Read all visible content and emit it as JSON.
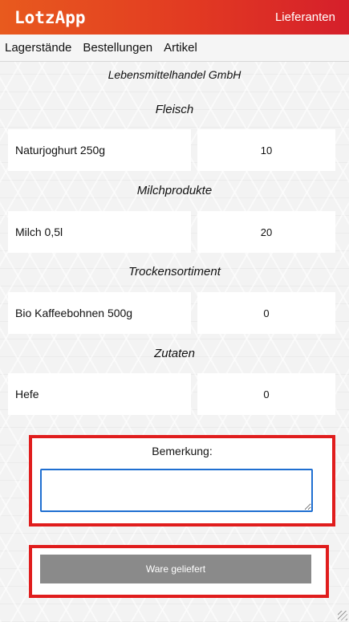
{
  "header": {
    "logo": "LotzApp",
    "right_link": "Lieferanten"
  },
  "nav": {
    "items": [
      "Lagerstände",
      "Bestellungen",
      "Artikel"
    ]
  },
  "company": "Lebensmittelhandel GmbH",
  "categories": [
    {
      "title": "Fleisch",
      "item": "Naturjoghurt 250g",
      "qty": "10"
    },
    {
      "title": "Milchprodukte",
      "item": "Milch 0,5l",
      "qty": "20"
    },
    {
      "title": "Trockensortiment",
      "item": "Bio Kaffeebohnen 500g",
      "qty": "0"
    },
    {
      "title": "Zutaten",
      "item": "Hefe",
      "qty": "0"
    }
  ],
  "remark": {
    "label": "Bemerkung:",
    "value": ""
  },
  "submit": {
    "label": "Ware geliefert"
  },
  "colors": {
    "header_start": "#e85a1e",
    "header_end": "#d51f2b",
    "highlight": "#e01d1d",
    "button": "#8a8a8a"
  }
}
